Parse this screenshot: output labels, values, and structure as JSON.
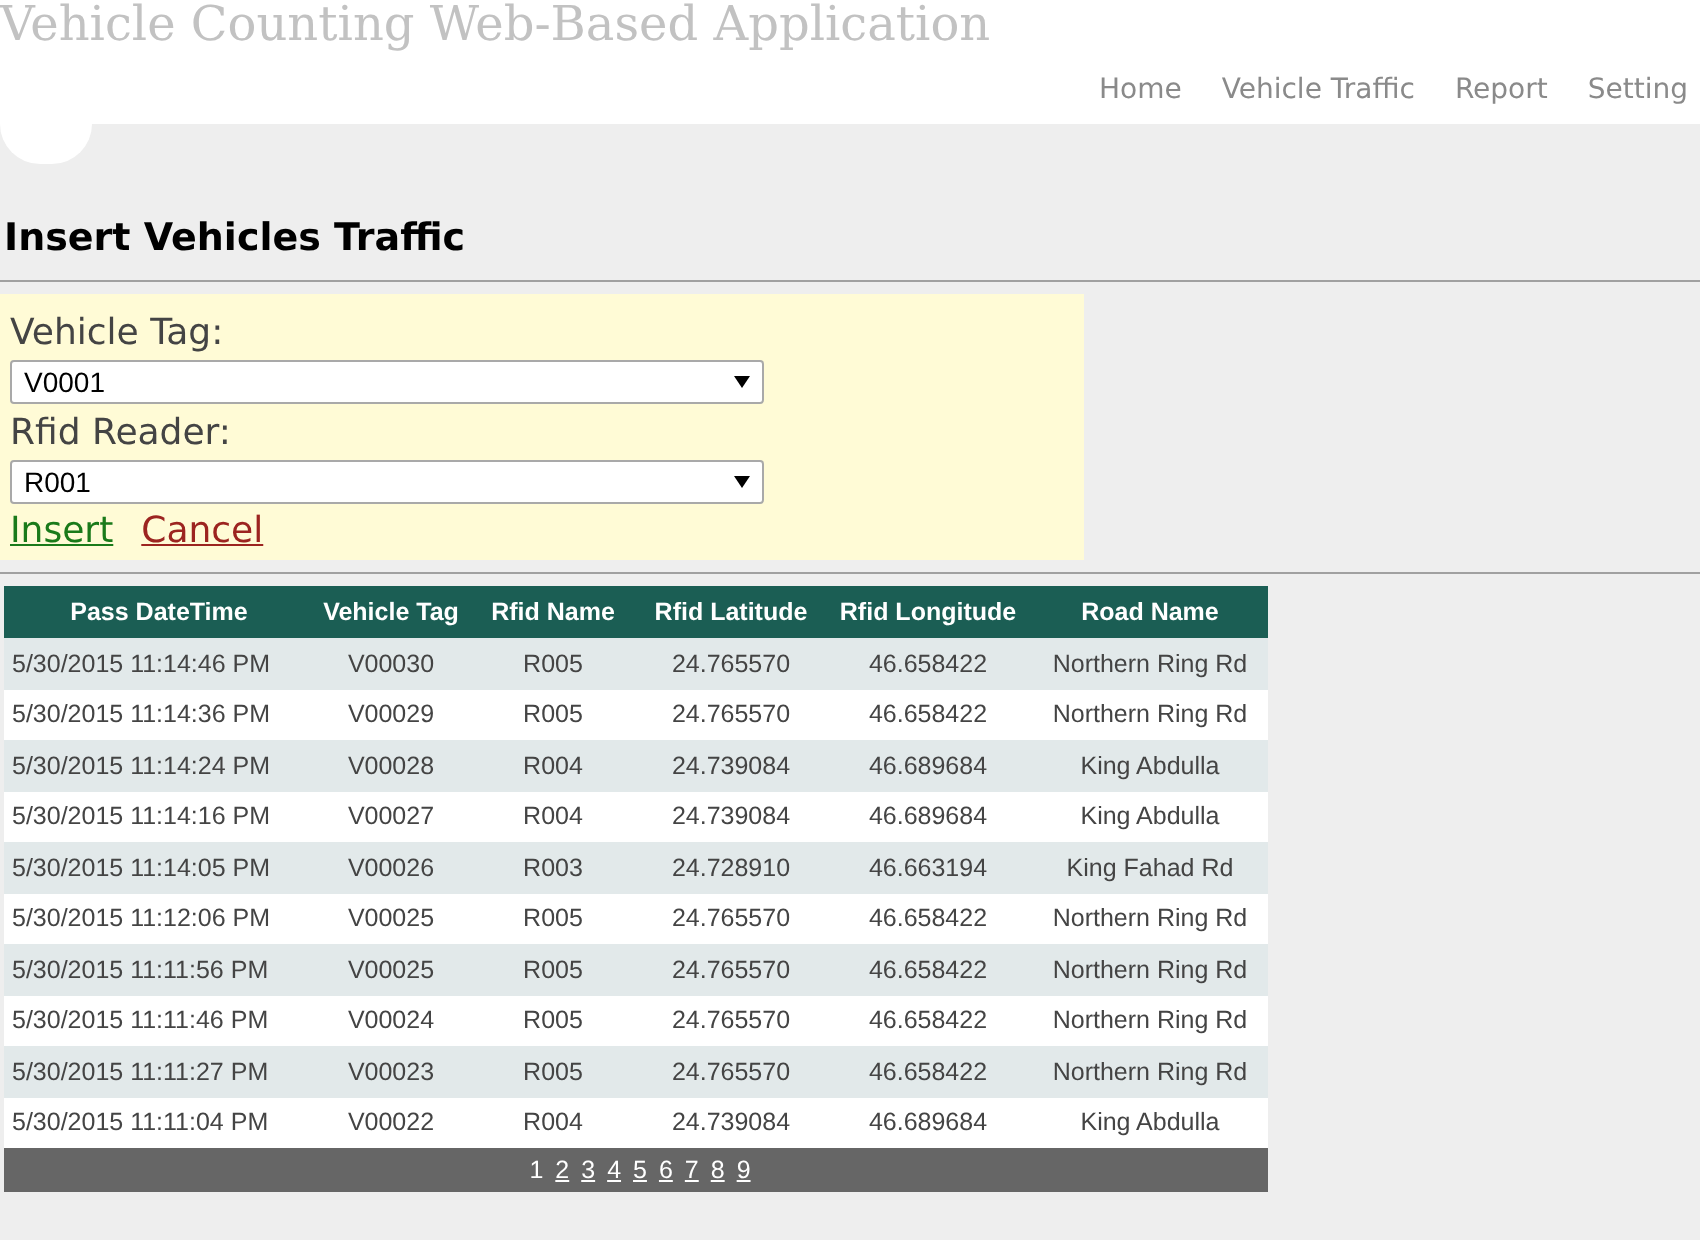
{
  "header": {
    "title": "Vehicle Counting Web-Based Application",
    "nav": [
      "Home",
      "Vehicle Traffic",
      "Report",
      "Setting"
    ]
  },
  "page_title": "Insert Vehicles Traffic",
  "form": {
    "fields": [
      {
        "label": "Vehicle Tag:",
        "value": "V0001"
      },
      {
        "label": "Rfid Reader:",
        "value": "R001"
      }
    ],
    "actions": [
      {
        "kind": "insert",
        "label": "Insert"
      },
      {
        "kind": "cancel",
        "label": "Cancel"
      }
    ]
  },
  "table": {
    "columns": [
      "Pass DateTime",
      "Vehicle Tag",
      "Rfid Name",
      "Rfid Latitude",
      "Rfid Longitude",
      "Road Name"
    ],
    "rows": [
      [
        "5/30/2015 11:14:46 PM",
        "V00030",
        "R005",
        "24.765570",
        "46.658422",
        "Northern Ring Rd"
      ],
      [
        "5/30/2015 11:14:36 PM",
        "V00029",
        "R005",
        "24.765570",
        "46.658422",
        "Northern Ring Rd"
      ],
      [
        "5/30/2015 11:14:24 PM",
        "V00028",
        "R004",
        "24.739084",
        "46.689684",
        "King Abdulla"
      ],
      [
        "5/30/2015 11:14:16 PM",
        "V00027",
        "R004",
        "24.739084",
        "46.689684",
        "King Abdulla"
      ],
      [
        "5/30/2015 11:14:05 PM",
        "V00026",
        "R003",
        "24.728910",
        "46.663194",
        "King Fahad Rd"
      ],
      [
        "5/30/2015 11:12:06 PM",
        "V00025",
        "R005",
        "24.765570",
        "46.658422",
        "Northern Ring Rd"
      ],
      [
        "5/30/2015 11:11:56 PM",
        "V00025",
        "R005",
        "24.765570",
        "46.658422",
        "Northern Ring Rd"
      ],
      [
        "5/30/2015 11:11:46 PM",
        "V00024",
        "R005",
        "24.765570",
        "46.658422",
        "Northern Ring Rd"
      ],
      [
        "5/30/2015 11:11:27 PM",
        "V00023",
        "R005",
        "24.765570",
        "46.658422",
        "Northern Ring Rd"
      ],
      [
        "5/30/2015 11:11:04 PM",
        "V00022",
        "R004",
        "24.739084",
        "46.689684",
        "King Abdulla"
      ]
    ],
    "pages": [
      {
        "label": "1",
        "selected": true
      },
      {
        "label": "2",
        "selected": false
      },
      {
        "label": "3",
        "selected": false
      },
      {
        "label": "4",
        "selected": false
      },
      {
        "label": "5",
        "selected": false
      },
      {
        "label": "6",
        "selected": false
      },
      {
        "label": "7",
        "selected": false
      },
      {
        "label": "8",
        "selected": false
      },
      {
        "label": "9",
        "selected": false
      }
    ]
  }
}
